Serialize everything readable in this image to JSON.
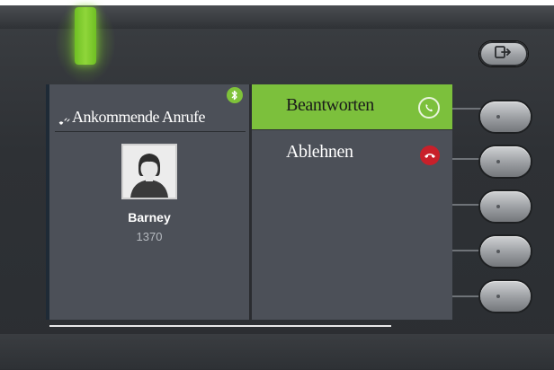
{
  "screen": {
    "header_title": "Ankommende Anrufe",
    "caller": {
      "name": "Barney",
      "number": "1370"
    },
    "options": [
      {
        "label": "Beantworten",
        "icon": "answer-call-icon",
        "selected": true
      },
      {
        "label": "Ablehnen",
        "icon": "decline-call-icon",
        "selected": false
      }
    ]
  },
  "icons": {
    "bluetooth": "bluetooth-icon",
    "ringing": "ringing-icon",
    "exit": "exit-icon",
    "avatar": "user-avatar-icon"
  },
  "colors": {
    "accent": "#7cc03c",
    "decline": "#c8202a",
    "led": "#8fd63a",
    "screen_bg": "#4c5058"
  }
}
